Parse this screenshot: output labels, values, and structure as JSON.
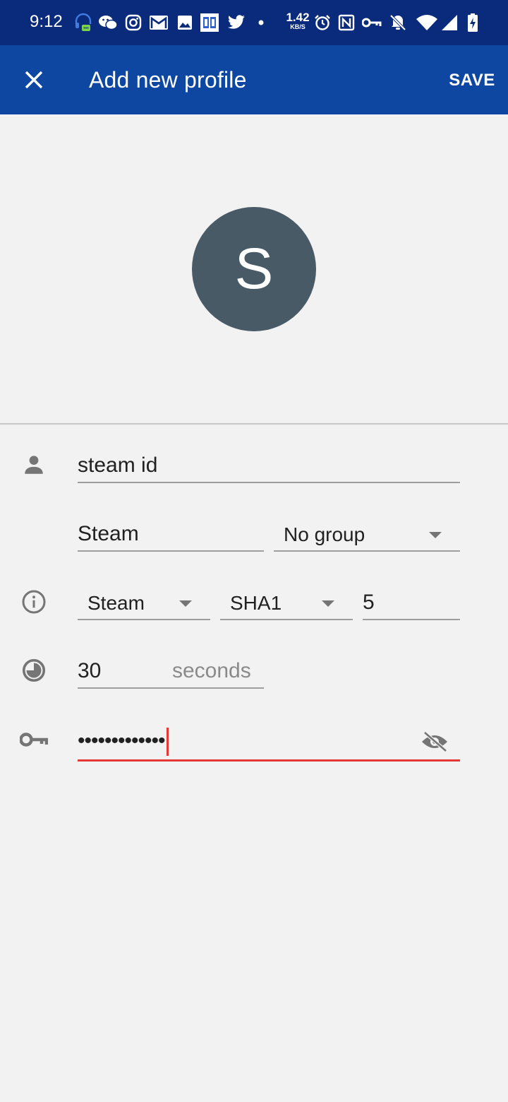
{
  "status_bar": {
    "time": "9:12",
    "net_speed_value": "1.42",
    "net_speed_unit": "KB/S",
    "icons": [
      "headset-chat-icon",
      "wechat-icon",
      "instagram-icon",
      "gmail-icon",
      "photo-icon",
      "calendar-app-icon",
      "twitter-icon",
      "dot-icon",
      "alarm-icon",
      "nfc-icon",
      "vpn-key-icon",
      "notifications-off-icon",
      "wifi-icon",
      "cell-signal-icon",
      "battery-charging-icon"
    ]
  },
  "app_bar": {
    "title": "Add new profile",
    "save_label": "SAVE",
    "background": "#0d47a1"
  },
  "avatar": {
    "letter": "S",
    "color": "#485a66"
  },
  "form": {
    "account_name": "steam id",
    "issuer": "Steam",
    "group": "No group",
    "token_type": "Steam",
    "algorithm": "SHA1",
    "digits": "5",
    "period": "30",
    "period_unit": "seconds",
    "secret_masked": "•••••••••••••"
  },
  "colors": {
    "accent_error": "#e53935",
    "icon_gray": "#757575"
  }
}
